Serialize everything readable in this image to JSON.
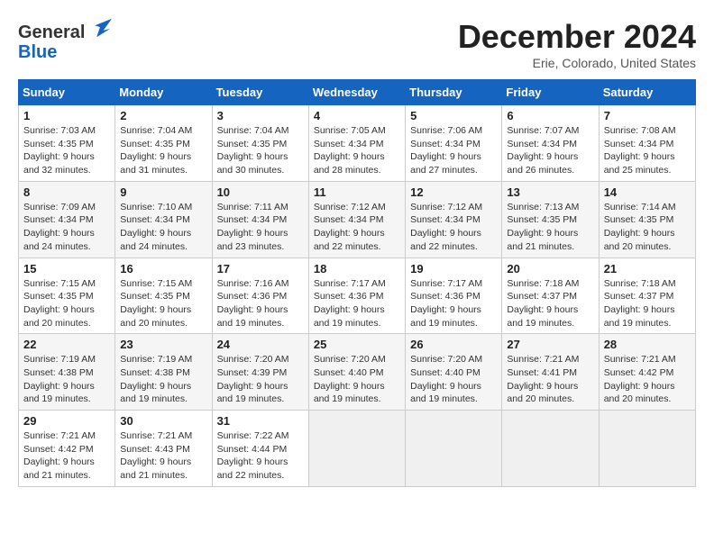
{
  "header": {
    "logo_line1": "General",
    "logo_line2": "Blue",
    "month_title": "December 2024",
    "location": "Erie, Colorado, United States"
  },
  "days_of_week": [
    "Sunday",
    "Monday",
    "Tuesday",
    "Wednesday",
    "Thursday",
    "Friday",
    "Saturday"
  ],
  "weeks": [
    [
      {
        "day": "1",
        "sunrise": "Sunrise: 7:03 AM",
        "sunset": "Sunset: 4:35 PM",
        "daylight": "Daylight: 9 hours and 32 minutes."
      },
      {
        "day": "2",
        "sunrise": "Sunrise: 7:04 AM",
        "sunset": "Sunset: 4:35 PM",
        "daylight": "Daylight: 9 hours and 31 minutes."
      },
      {
        "day": "3",
        "sunrise": "Sunrise: 7:04 AM",
        "sunset": "Sunset: 4:35 PM",
        "daylight": "Daylight: 9 hours and 30 minutes."
      },
      {
        "day": "4",
        "sunrise": "Sunrise: 7:05 AM",
        "sunset": "Sunset: 4:34 PM",
        "daylight": "Daylight: 9 hours and 28 minutes."
      },
      {
        "day": "5",
        "sunrise": "Sunrise: 7:06 AM",
        "sunset": "Sunset: 4:34 PM",
        "daylight": "Daylight: 9 hours and 27 minutes."
      },
      {
        "day": "6",
        "sunrise": "Sunrise: 7:07 AM",
        "sunset": "Sunset: 4:34 PM",
        "daylight": "Daylight: 9 hours and 26 minutes."
      },
      {
        "day": "7",
        "sunrise": "Sunrise: 7:08 AM",
        "sunset": "Sunset: 4:34 PM",
        "daylight": "Daylight: 9 hours and 25 minutes."
      }
    ],
    [
      {
        "day": "8",
        "sunrise": "Sunrise: 7:09 AM",
        "sunset": "Sunset: 4:34 PM",
        "daylight": "Daylight: 9 hours and 24 minutes."
      },
      {
        "day": "9",
        "sunrise": "Sunrise: 7:10 AM",
        "sunset": "Sunset: 4:34 PM",
        "daylight": "Daylight: 9 hours and 24 minutes."
      },
      {
        "day": "10",
        "sunrise": "Sunrise: 7:11 AM",
        "sunset": "Sunset: 4:34 PM",
        "daylight": "Daylight: 9 hours and 23 minutes."
      },
      {
        "day": "11",
        "sunrise": "Sunrise: 7:12 AM",
        "sunset": "Sunset: 4:34 PM",
        "daylight": "Daylight: 9 hours and 22 minutes."
      },
      {
        "day": "12",
        "sunrise": "Sunrise: 7:12 AM",
        "sunset": "Sunset: 4:34 PM",
        "daylight": "Daylight: 9 hours and 22 minutes."
      },
      {
        "day": "13",
        "sunrise": "Sunrise: 7:13 AM",
        "sunset": "Sunset: 4:35 PM",
        "daylight": "Daylight: 9 hours and 21 minutes."
      },
      {
        "day": "14",
        "sunrise": "Sunrise: 7:14 AM",
        "sunset": "Sunset: 4:35 PM",
        "daylight": "Daylight: 9 hours and 20 minutes."
      }
    ],
    [
      {
        "day": "15",
        "sunrise": "Sunrise: 7:15 AM",
        "sunset": "Sunset: 4:35 PM",
        "daylight": "Daylight: 9 hours and 20 minutes."
      },
      {
        "day": "16",
        "sunrise": "Sunrise: 7:15 AM",
        "sunset": "Sunset: 4:35 PM",
        "daylight": "Daylight: 9 hours and 20 minutes."
      },
      {
        "day": "17",
        "sunrise": "Sunrise: 7:16 AM",
        "sunset": "Sunset: 4:36 PM",
        "daylight": "Daylight: 9 hours and 19 minutes."
      },
      {
        "day": "18",
        "sunrise": "Sunrise: 7:17 AM",
        "sunset": "Sunset: 4:36 PM",
        "daylight": "Daylight: 9 hours and 19 minutes."
      },
      {
        "day": "19",
        "sunrise": "Sunrise: 7:17 AM",
        "sunset": "Sunset: 4:36 PM",
        "daylight": "Daylight: 9 hours and 19 minutes."
      },
      {
        "day": "20",
        "sunrise": "Sunrise: 7:18 AM",
        "sunset": "Sunset: 4:37 PM",
        "daylight": "Daylight: 9 hours and 19 minutes."
      },
      {
        "day": "21",
        "sunrise": "Sunrise: 7:18 AM",
        "sunset": "Sunset: 4:37 PM",
        "daylight": "Daylight: 9 hours and 19 minutes."
      }
    ],
    [
      {
        "day": "22",
        "sunrise": "Sunrise: 7:19 AM",
        "sunset": "Sunset: 4:38 PM",
        "daylight": "Daylight: 9 hours and 19 minutes."
      },
      {
        "day": "23",
        "sunrise": "Sunrise: 7:19 AM",
        "sunset": "Sunset: 4:38 PM",
        "daylight": "Daylight: 9 hours and 19 minutes."
      },
      {
        "day": "24",
        "sunrise": "Sunrise: 7:20 AM",
        "sunset": "Sunset: 4:39 PM",
        "daylight": "Daylight: 9 hours and 19 minutes."
      },
      {
        "day": "25",
        "sunrise": "Sunrise: 7:20 AM",
        "sunset": "Sunset: 4:40 PM",
        "daylight": "Daylight: 9 hours and 19 minutes."
      },
      {
        "day": "26",
        "sunrise": "Sunrise: 7:20 AM",
        "sunset": "Sunset: 4:40 PM",
        "daylight": "Daylight: 9 hours and 19 minutes."
      },
      {
        "day": "27",
        "sunrise": "Sunrise: 7:21 AM",
        "sunset": "Sunset: 4:41 PM",
        "daylight": "Daylight: 9 hours and 20 minutes."
      },
      {
        "day": "28",
        "sunrise": "Sunrise: 7:21 AM",
        "sunset": "Sunset: 4:42 PM",
        "daylight": "Daylight: 9 hours and 20 minutes."
      }
    ],
    [
      {
        "day": "29",
        "sunrise": "Sunrise: 7:21 AM",
        "sunset": "Sunset: 4:42 PM",
        "daylight": "Daylight: 9 hours and 21 minutes."
      },
      {
        "day": "30",
        "sunrise": "Sunrise: 7:21 AM",
        "sunset": "Sunset: 4:43 PM",
        "daylight": "Daylight: 9 hours and 21 minutes."
      },
      {
        "day": "31",
        "sunrise": "Sunrise: 7:22 AM",
        "sunset": "Sunset: 4:44 PM",
        "daylight": "Daylight: 9 hours and 22 minutes."
      },
      null,
      null,
      null,
      null
    ]
  ]
}
